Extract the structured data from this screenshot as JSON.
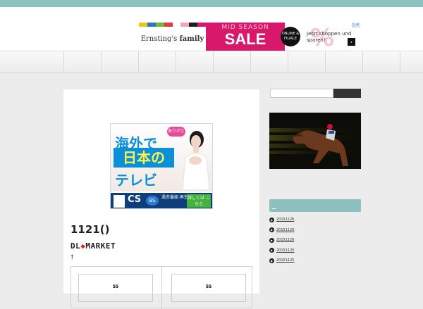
{
  "ad_banner": {
    "brand_name": "Ernsting's",
    "brand_bold": "family",
    "headline_small": "MID SEASON",
    "headline": "SALE",
    "sticker": "ONLINE & FILIALE",
    "percent": "%",
    "cta": "Jetzt shoppen und sparen!",
    "arrow": "›",
    "adchoice": "▷✕",
    "strip_colors": [
      "#f0c419",
      "#2e74c9",
      "#6fb83b",
      "#e23b44",
      "#ffffff",
      "#f2a6c0",
      "#1f1f1f",
      "#d8186a"
    ]
  },
  "navbar": {
    "item_count": 10
  },
  "jp_ad": {
    "line1": "海外で",
    "line2": "日本の",
    "line3": "テレビ",
    "thanks": "ありがとう",
    "cs": "CS",
    "bs": "BS",
    "info": "過去番組 再生機能",
    "button": "詳しくは こちら"
  },
  "post": {
    "title": "1121()",
    "dlmarket_left": "DL",
    "dlmarket_mid": "◆",
    "dlmarket_right": "MARKET",
    "dagger": "†",
    "cells": [
      "55",
      "55"
    ]
  },
  "sidebar": {
    "recent_posts": [
      {
        "label": "20151126"
      },
      {
        "label": "20151126"
      },
      {
        "label": "20151126"
      },
      {
        "label": "20151125"
      },
      {
        "label": "20151125"
      }
    ],
    "bullet": "▶"
  },
  "colors": {
    "accent": "#8cc0c1",
    "sale_pink": "#d8186a",
    "jp_blue": "#0a8fd8"
  }
}
